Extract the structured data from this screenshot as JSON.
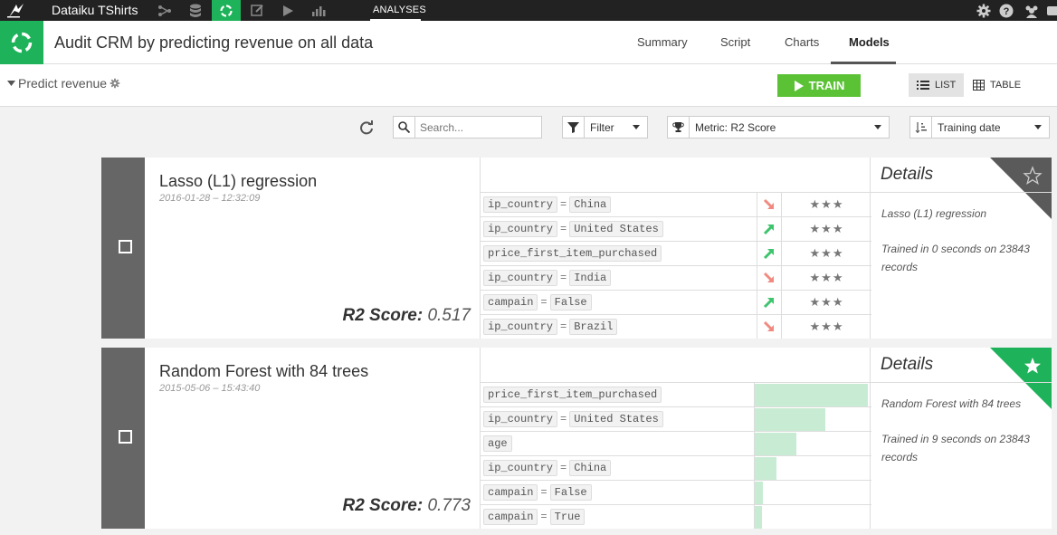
{
  "topbar": {
    "project_name": "Dataiku TShirts",
    "section": "ANALYSES",
    "icons": [
      "flow-icon",
      "datasets-icon",
      "analysis-icon",
      "notebook-icon",
      "jobs-icon",
      "dashboard-icon",
      "gear-icon",
      "help-icon",
      "users-icon"
    ]
  },
  "header": {
    "title": "Audit CRM by predicting revenue on all data",
    "tabs": [
      {
        "label": "Summary"
      },
      {
        "label": "Script"
      },
      {
        "label": "Charts"
      },
      {
        "label": "Models"
      }
    ],
    "active_tab": "Models"
  },
  "subheader": {
    "task_name": "Predict revenue",
    "train_label": "TRAIN",
    "list_label": "LIST",
    "table_label": "TABLE"
  },
  "toolbar": {
    "search_placeholder": "Search...",
    "filter_label": "Filter",
    "metric_label": "Metric: R2 Score",
    "sort_label": "Training date"
  },
  "models": [
    {
      "name": "Lasso (L1) regression",
      "date": "2016-01-28 – 12:32:09",
      "score_label": "R2 Score:",
      "score_value": "0.517",
      "details_title": "Details",
      "details_name": "Lasso (L1) regression",
      "details_training": "Trained in 0 seconds on 23843 records",
      "starred": false,
      "features": [
        {
          "name": "ip_country",
          "eq": "=",
          "value": "China",
          "direction": "down",
          "stars": "★★★"
        },
        {
          "name": "ip_country",
          "eq": "=",
          "value": "United States",
          "direction": "up",
          "stars": "★★★"
        },
        {
          "name": "price_first_item_purchased",
          "eq": "",
          "value": "",
          "direction": "up",
          "stars": "★★★"
        },
        {
          "name": "ip_country",
          "eq": "=",
          "value": "India",
          "direction": "down",
          "stars": "★★★"
        },
        {
          "name": "campain",
          "eq": "=",
          "value": "False",
          "direction": "up",
          "stars": "★★★"
        },
        {
          "name": "ip_country",
          "eq": "=",
          "value": "Brazil",
          "direction": "down",
          "stars": "★★★"
        }
      ]
    },
    {
      "name": "Random Forest with 84 trees",
      "date": "2015-05-06 – 15:43:40",
      "score_label": "R2 Score:",
      "score_value": "0.773",
      "details_title": "Details",
      "details_name": "Random Forest with 84 trees",
      "details_training": "Trained in 9 seconds on 23843 records",
      "starred": true,
      "features": [
        {
          "name": "price_first_item_purchased",
          "eq": "",
          "value": "",
          "importance": 1.0
        },
        {
          "name": "ip_country",
          "eq": "=",
          "value": "United States",
          "importance": 0.62
        },
        {
          "name": "age",
          "eq": "",
          "value": "",
          "importance": 0.37
        },
        {
          "name": "ip_country",
          "eq": "=",
          "value": "China",
          "importance": 0.19
        },
        {
          "name": "campain",
          "eq": "=",
          "value": "False",
          "importance": 0.07
        },
        {
          "name": "campain",
          "eq": "=",
          "value": "True",
          "importance": 0.06
        }
      ]
    }
  ],
  "colors": {
    "accent_green": "#1eb35a",
    "train_green": "#5bc236",
    "corner_dark": "#5a5a5a",
    "importance_bar": "#c8ecd3",
    "arrow_up": "#3ec46d",
    "arrow_down": "#f08a80"
  }
}
